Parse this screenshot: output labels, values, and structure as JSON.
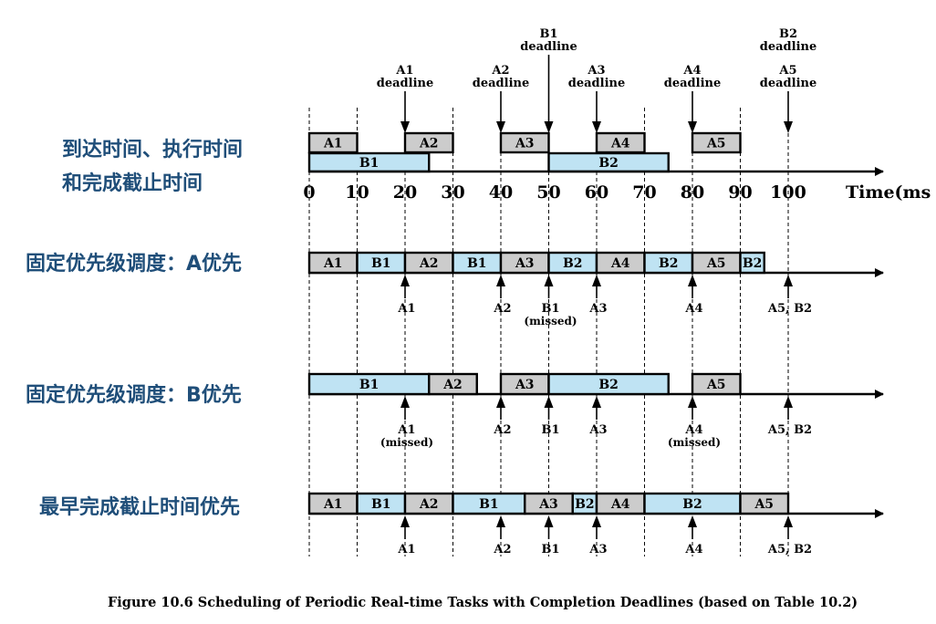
{
  "labels": {
    "row0_line1": "到达时间、执行时间",
    "row0_line2": "和完成截止时间",
    "row1": "固定优先级调度：A优先",
    "row2": "固定优先级调度：B优先",
    "row3": "最早完成截止时间优先"
  },
  "axis": {
    "ticks": [
      0,
      10,
      20,
      30,
      40,
      50,
      60,
      70,
      80,
      90,
      100
    ],
    "unit_label": "Time(ms",
    "range": [
      0,
      100
    ]
  },
  "colors": {
    "task_a": "#cccccc",
    "task_b": "#bfe3f3",
    "label_text": "#1f4e79",
    "line": "#000000"
  },
  "deadlines_top": [
    {
      "t": 20,
      "label": "A1",
      "sub": "deadline",
      "tall": false
    },
    {
      "t": 40,
      "label": "A2",
      "sub": "deadline",
      "tall": false
    },
    {
      "t": 50,
      "label": "B1",
      "sub": "deadline",
      "tall": true
    },
    {
      "t": 60,
      "label": "A3",
      "sub": "deadline",
      "tall": false
    },
    {
      "t": 80,
      "label": "A4",
      "sub": "deadline",
      "tall": false
    },
    {
      "t": 100,
      "label": "A5",
      "sub": "deadline",
      "tall": false
    },
    {
      "t": 100,
      "label": "B2",
      "sub": "deadline",
      "tall": true
    }
  ],
  "arrival_row": {
    "a_tasks": [
      {
        "name": "A1",
        "start": 0,
        "end": 10
      },
      {
        "name": "A2",
        "start": 20,
        "end": 30
      },
      {
        "name": "A3",
        "start": 40,
        "end": 50
      },
      {
        "name": "A4",
        "start": 60,
        "end": 70
      },
      {
        "name": "A5",
        "start": 80,
        "end": 90
      }
    ],
    "b_tasks": [
      {
        "name": "B1",
        "start": 0,
        "end": 25
      },
      {
        "name": "B2",
        "start": 50,
        "end": 75
      }
    ]
  },
  "schedules": [
    {
      "id": "a-priority",
      "segments": [
        {
          "name": "A1",
          "type": "A",
          "start": 0,
          "end": 10
        },
        {
          "name": "B1",
          "type": "B",
          "start": 10,
          "end": 20
        },
        {
          "name": "A2",
          "type": "A",
          "start": 20,
          "end": 30
        },
        {
          "name": "B1",
          "type": "B",
          "start": 30,
          "end": 40
        },
        {
          "name": "A3",
          "type": "A",
          "start": 40,
          "end": 50
        },
        {
          "name": "B2",
          "type": "B",
          "start": 50,
          "end": 60
        },
        {
          "name": "A4",
          "type": "A",
          "start": 60,
          "end": 70
        },
        {
          "name": "B2",
          "type": "B",
          "start": 70,
          "end": 80
        },
        {
          "name": "A5",
          "type": "A",
          "start": 80,
          "end": 90
        },
        {
          "name": "B2",
          "type": "B",
          "start": 90,
          "end": 95
        }
      ],
      "markers": [
        {
          "t": 20,
          "label": "A1"
        },
        {
          "t": 40,
          "label": "A2"
        },
        {
          "t": 50,
          "label": "B1",
          "note": "(missed)"
        },
        {
          "t": 60,
          "label": "A3"
        },
        {
          "t": 80,
          "label": "A4"
        },
        {
          "t": 100,
          "label": "A5, B2"
        }
      ]
    },
    {
      "id": "b-priority",
      "segments": [
        {
          "name": "B1",
          "type": "B",
          "start": 0,
          "end": 25
        },
        {
          "name": "A2",
          "type": "A",
          "start": 25,
          "end": 35
        },
        {
          "name": "A3",
          "type": "A",
          "start": 40,
          "end": 50
        },
        {
          "name": "B2",
          "type": "B",
          "start": 50,
          "end": 75
        },
        {
          "name": "A5",
          "type": "A",
          "start": 80,
          "end": 90
        }
      ],
      "markers": [
        {
          "t": 20,
          "label": "A1",
          "note": "(missed)"
        },
        {
          "t": 40,
          "label": "A2"
        },
        {
          "t": 50,
          "label": "B1"
        },
        {
          "t": 60,
          "label": "A3"
        },
        {
          "t": 80,
          "label": "A4",
          "note": "(missed)"
        },
        {
          "t": 100,
          "label": "A5, B2"
        }
      ]
    },
    {
      "id": "edf",
      "segments": [
        {
          "name": "A1",
          "type": "A",
          "start": 0,
          "end": 10
        },
        {
          "name": "B1",
          "type": "B",
          "start": 10,
          "end": 20
        },
        {
          "name": "A2",
          "type": "A",
          "start": 20,
          "end": 30
        },
        {
          "name": "B1",
          "type": "B",
          "start": 30,
          "end": 45
        },
        {
          "name": "A3",
          "type": "A",
          "start": 45,
          "end": 55
        },
        {
          "name": "B2",
          "type": "B",
          "start": 55,
          "end": 60
        },
        {
          "name": "A4",
          "type": "A",
          "start": 60,
          "end": 70
        },
        {
          "name": "B2",
          "type": "B",
          "start": 70,
          "end": 90
        },
        {
          "name": "A5",
          "type": "A",
          "start": 90,
          "end": 100
        }
      ],
      "markers": [
        {
          "t": 20,
          "label": "A1"
        },
        {
          "t": 40,
          "label": "A2"
        },
        {
          "t": 50,
          "label": "B1"
        },
        {
          "t": 60,
          "label": "A3"
        },
        {
          "t": 80,
          "label": "A4"
        },
        {
          "t": 100,
          "label": "A5, B2"
        }
      ]
    }
  ],
  "caption": "Figure 10.6  Scheduling of Periodic Real-time Tasks with Completion Deadlines (based on Table 10.2)"
}
